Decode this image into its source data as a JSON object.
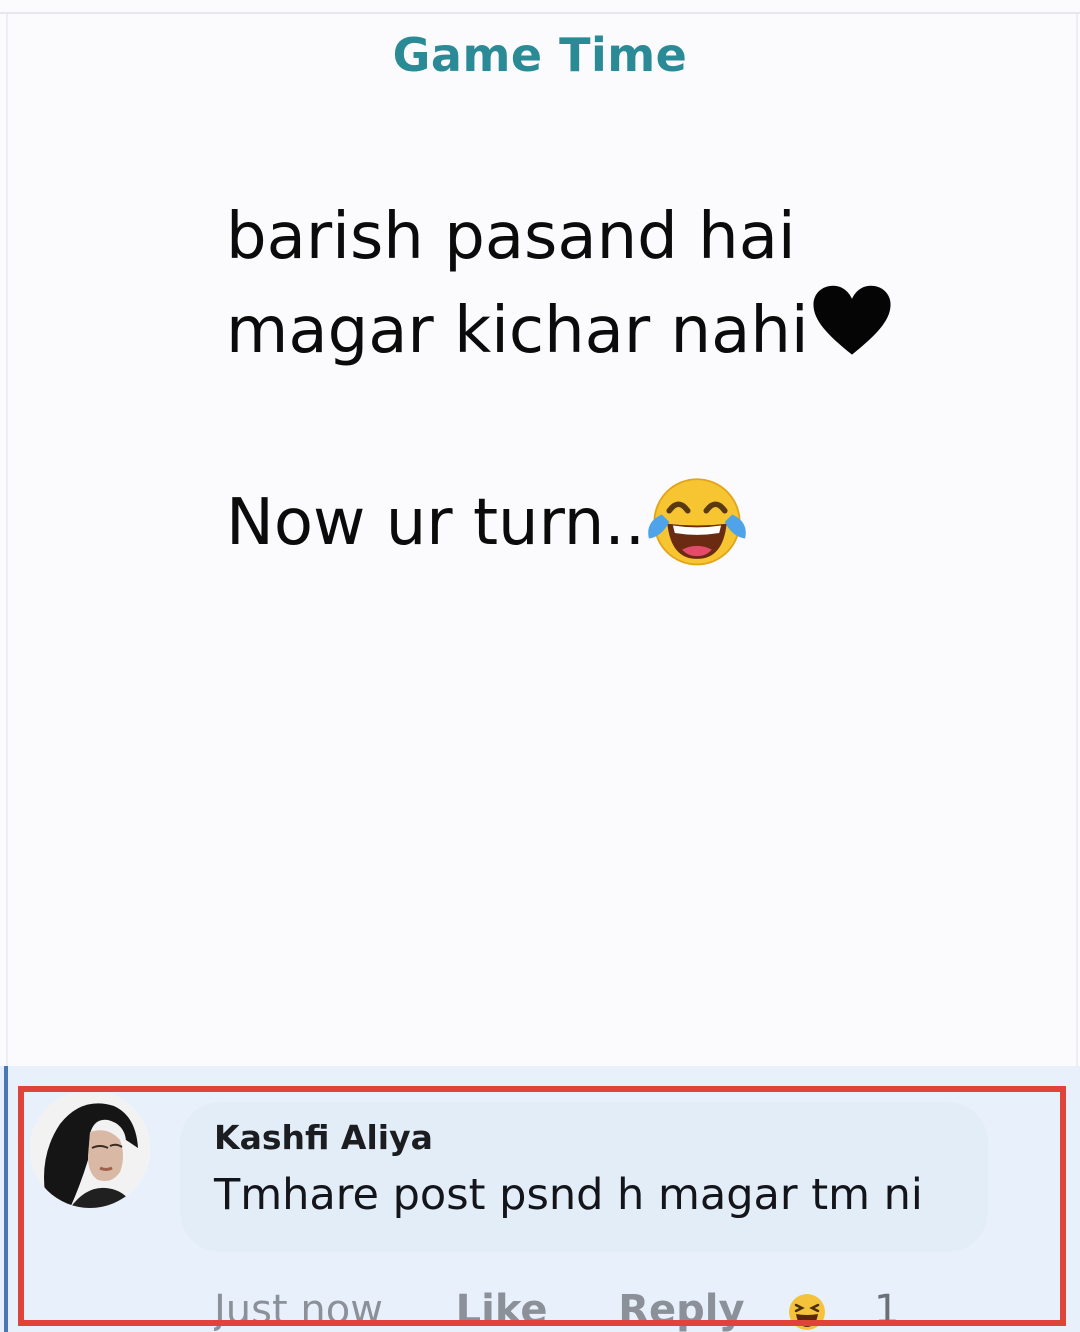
{
  "post": {
    "header": "Game Time",
    "line1": "barish pasand hai",
    "line2": "magar kichar nahi",
    "line3": "Now ur turn..",
    "line2_emoji": "black-heart-icon",
    "line3_emoji": "face-with-tears-of-joy-icon"
  },
  "comment": {
    "author": "Kashfi Aliya",
    "text": "Tmhare post psnd h magar tm ni",
    "time": "Just now",
    "like_label": "Like",
    "reply_label": "Reply",
    "reaction_icon": "laughing-face-icon",
    "reaction_count": "1"
  },
  "colors": {
    "header": "#2a8b96",
    "highlight_border": "#e0433a",
    "comment_background": "#e8f1fb",
    "action_text": "#8b9099"
  }
}
